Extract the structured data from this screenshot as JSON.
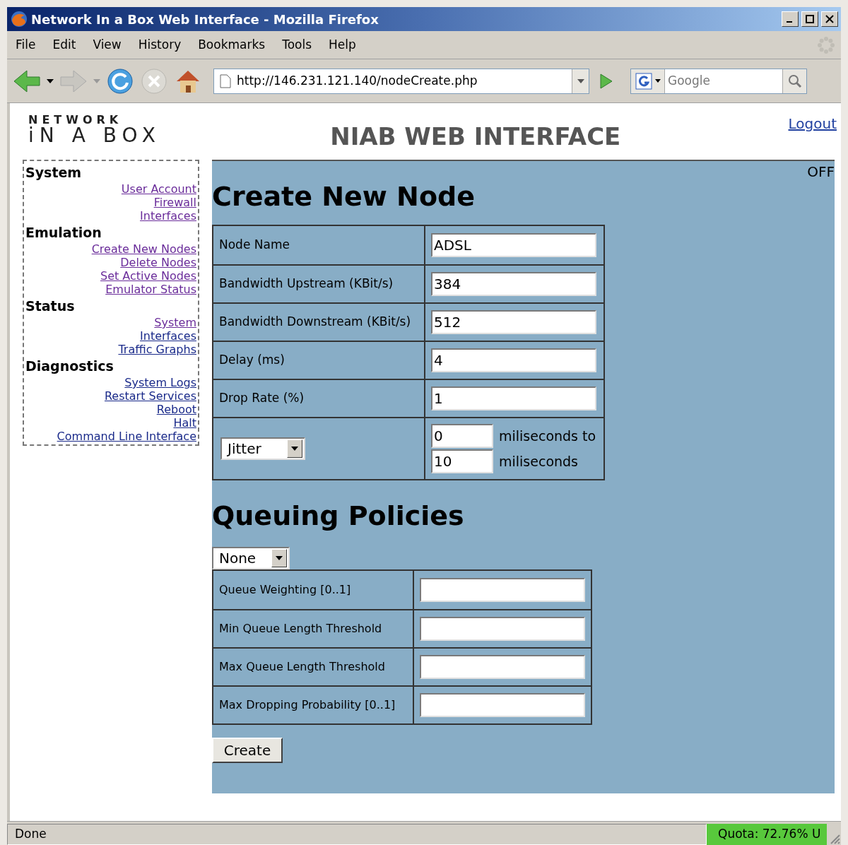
{
  "window": {
    "title": "Network In a Box Web Interface - Mozilla Firefox"
  },
  "menu": [
    "File",
    "Edit",
    "View",
    "History",
    "Bookmarks",
    "Tools",
    "Help"
  ],
  "address_bar": {
    "value": "http://146.231.121.140/nodeCreate.php"
  },
  "search_bar": {
    "placeholder": "Google"
  },
  "page": {
    "logo": {
      "line1": "NETWORK",
      "line2": "iN A BOX"
    },
    "title": "NIAB WEB INTERFACE",
    "logout": "Logout",
    "indicator": "OFF"
  },
  "sidebar": [
    {
      "heading": "System",
      "links": [
        {
          "label": "User Account",
          "visited": true
        },
        {
          "label": "Firewall",
          "visited": true
        },
        {
          "label": "Interfaces",
          "visited": true
        }
      ]
    },
    {
      "heading": "Emulation",
      "links": [
        {
          "label": "Create New Nodes",
          "visited": true
        },
        {
          "label": "Delete Nodes",
          "visited": true
        },
        {
          "label": "Set Active Nodes",
          "visited": true
        },
        {
          "label": "Emulator Status",
          "visited": true
        }
      ]
    },
    {
      "heading": "Status",
      "links": [
        {
          "label": "System",
          "visited": true
        },
        {
          "label": "Interfaces",
          "visited": false
        },
        {
          "label": "Traffic Graphs",
          "visited": false
        }
      ]
    },
    {
      "heading": "Diagnostics",
      "links": [
        {
          "label": "System Logs",
          "visited": false
        },
        {
          "label": "Restart Services",
          "visited": false
        },
        {
          "label": "Reboot",
          "visited": false
        },
        {
          "label": "Halt",
          "visited": false
        },
        {
          "label": "Command Line Interface",
          "visited": false
        }
      ]
    }
  ],
  "node_form": {
    "heading": "Create New Node",
    "rows": [
      {
        "kind": "field",
        "label": "Node Name",
        "value": "ADSL"
      },
      {
        "kind": "field",
        "label": "Bandwidth Upstream (KBit/s)",
        "value": "384"
      },
      {
        "kind": "field",
        "label": "Bandwidth Downstream (KBit/s)",
        "value": "512"
      },
      {
        "kind": "field",
        "label": "Delay (ms)",
        "value": "4"
      },
      {
        "kind": "field",
        "label": "Drop Rate (%)",
        "value": "1"
      },
      {
        "kind": "range",
        "select": "Jitter",
        "from": "0",
        "from_unit": "miliseconds to",
        "to": "10",
        "to_unit": "miliseconds"
      }
    ]
  },
  "queue_form": {
    "heading": "Queuing Policies",
    "select": "None",
    "rows": [
      {
        "label": "Queue Weighting [0..1]"
      },
      {
        "label": "Min Queue Length Threshold"
      },
      {
        "label": "Max Queue Length Threshold"
      },
      {
        "label": "Max Dropping Probability [0..1]"
      }
    ]
  },
  "create_button": "Create",
  "status_bar": {
    "text": "Done",
    "quota": "Quota: 72.76% U"
  }
}
